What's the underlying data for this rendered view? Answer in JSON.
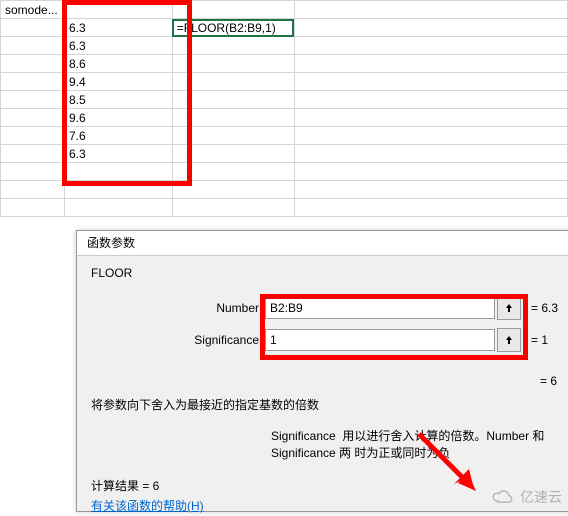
{
  "topleft_text": "somode...",
  "formula_text": "=FLOOR(B2:B9,1)",
  "col_b": [
    "6.3",
    "6.3",
    "8.6",
    "9.4",
    "8.5",
    "9.6",
    "7.6",
    "6.3"
  ],
  "dialog": {
    "title": "函数参数",
    "func": "FLOOR",
    "args": [
      {
        "label": "Number",
        "value": "B2:B9",
        "result": "= 6.3"
      },
      {
        "label": "Significance",
        "value": "1",
        "result": "= 1"
      }
    ],
    "lone_eq": "= 6",
    "desc1": "将参数向下舍入为最接近的指定基数的倍数",
    "desc2_label": "Significance",
    "desc2_text": "用以进行舍入计算的倍数。Number 和 Significance 两\n时为正或同时为负",
    "result_label": "计算结果 = 6",
    "help": "有关该函数的帮助(H)"
  },
  "watermark": "亿速云"
}
